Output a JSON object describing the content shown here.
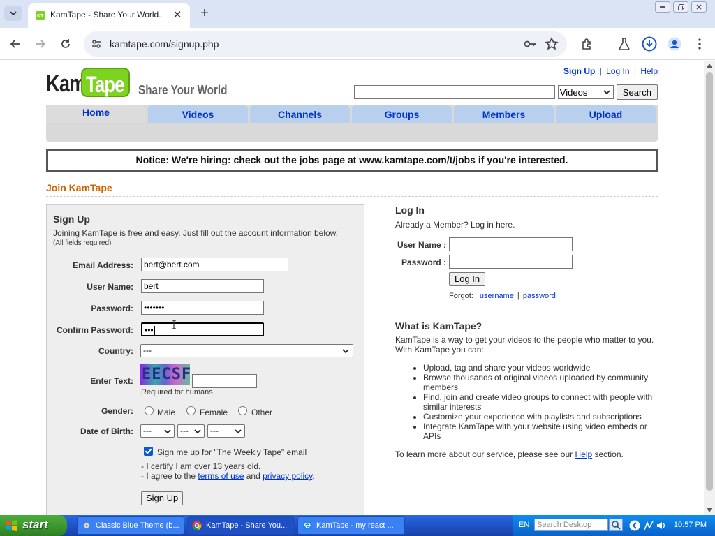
{
  "browser": {
    "tab_title": "KamTape - Share Your World.",
    "url": "kamtape.com/signup.php",
    "close_glyph": "✕",
    "new_tab_glyph": "+"
  },
  "header": {
    "logo_kam": "Kam",
    "logo_tape": "Tape",
    "tagline": "Share Your World",
    "links": {
      "signup": "Sign Up",
      "login": "Log In",
      "help": "Help",
      "sep": "|"
    },
    "search": {
      "value": "",
      "category": "Videos",
      "button": "Search"
    }
  },
  "nav": {
    "tabs": [
      {
        "label": "Home",
        "active": true
      },
      {
        "label": "Videos"
      },
      {
        "label": "Channels"
      },
      {
        "label": "Groups"
      },
      {
        "label": "Members"
      },
      {
        "label": "Upload"
      }
    ]
  },
  "notice": "Notice: We're hiring: check out the jobs page at www.kamtape.com/t/jobs if you're interested.",
  "join_title": "Join KamTape",
  "signup": {
    "title": "Sign Up",
    "description": "Joining KamTape is free and easy. Just fill out the account information below.",
    "required_note": "(All fields required)",
    "email_label": "Email Address:",
    "email_value": "bert@bert.com",
    "username_label": "User Name:",
    "username_value": "bert",
    "password_label": "Password:",
    "password_value": "•••••••",
    "confirm_label": "Confirm Password:",
    "confirm_value": "•••",
    "country_label": "Country:",
    "country_value": "---",
    "enter_text_label": "Enter Text:",
    "captcha_text": "EECSF",
    "captcha_hint": "Required for humans",
    "gender_label": "Gender:",
    "gender_options": [
      "Male",
      "Female",
      "Other"
    ],
    "dob_label": "Date of Birth:",
    "dob_values": [
      "---",
      "---",
      "---"
    ],
    "newsletter_label": "Sign me up for \"The Weekly Tape\" email",
    "certify_line1": "- I certify I am over 13 years old.",
    "certify_line2_prefix": "- I agree to the ",
    "terms_link": "terms of use",
    "and_text": " and ",
    "privacy_link": "privacy policy",
    "period": ".",
    "submit": "Sign Up"
  },
  "login": {
    "title": "Log In",
    "subtitle": "Already a Member? Log in here.",
    "username_label": "User Name :",
    "password_label": "Password :",
    "button": "Log In",
    "forgot_label": "Forgot:",
    "forgot_username": "username",
    "forgot_sep": "|",
    "forgot_password": "password"
  },
  "about": {
    "title": "What is KamTape?",
    "description": "KamTape is a way to get your videos to the people who matter to you. With KamTape you can:",
    "items": [
      "Upload, tag and share your videos worldwide",
      "Browse thousands of original videos uploaded by community members",
      "Find, join and create video groups to connect with people with similar interests",
      "Customize your experience with playlists and subscriptions",
      "Integrate KamTape with your website using video embeds or APIs"
    ],
    "footer_prefix": "To learn more about our service, please see our ",
    "footer_link": "Help",
    "footer_suffix": " section."
  },
  "taskbar": {
    "start": "start",
    "items": [
      "Classic Blue Theme (b...",
      "KamTape - Share You...",
      "KamTape - my react ..."
    ],
    "lang": "EN",
    "search_placeholder": "Search Desktop",
    "time": "10:57 PM"
  },
  "colors": {
    "link": "#0033cc",
    "accent_orange": "#cc6600",
    "nav_tab": "#b9cfee",
    "logo_green": "#7ed321"
  }
}
